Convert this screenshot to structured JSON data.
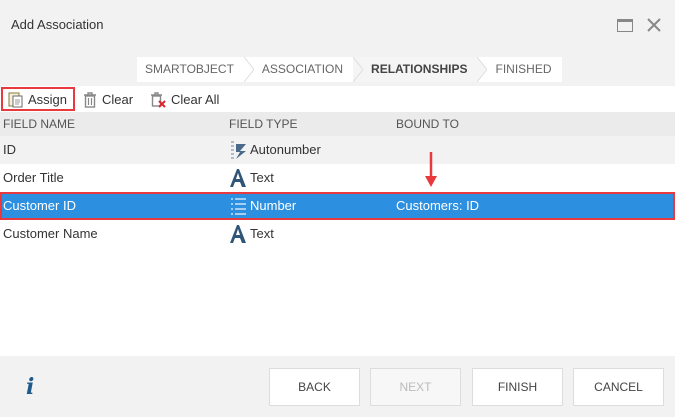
{
  "dialog": {
    "title": "Add Association"
  },
  "steps": [
    {
      "label": "SMARTOBJECT",
      "active": false
    },
    {
      "label": "ASSOCIATION",
      "active": false
    },
    {
      "label": "RELATIONSHIPS",
      "active": true
    },
    {
      "label": "FINISHED",
      "active": false
    }
  ],
  "toolbar": {
    "assign_label": "Assign",
    "clear_label": "Clear",
    "clear_all_label": "Clear All"
  },
  "grid": {
    "headers": {
      "field_name": "FIELD NAME",
      "field_type": "FIELD TYPE",
      "bound_to": "BOUND TO"
    },
    "rows": [
      {
        "field_name": "ID",
        "field_type": "Autonumber",
        "type_icon": "autonumber-icon",
        "bound_to": ""
      },
      {
        "field_name": "Order Title",
        "field_type": "Text",
        "type_icon": "text-type-icon",
        "bound_to": ""
      },
      {
        "field_name": "Customer ID",
        "field_type": "Number",
        "type_icon": "number-icon",
        "bound_to": "Customers: ID"
      },
      {
        "field_name": "Customer Name",
        "field_type": "Text",
        "type_icon": "text-type-icon",
        "bound_to": ""
      }
    ]
  },
  "footer": {
    "back_label": "BACK",
    "next_label": "NEXT",
    "finish_label": "FINISH",
    "cancel_label": "CANCEL"
  },
  "colors": {
    "selection": "#2d8fe0",
    "highlight": "#e8393f",
    "accent": "#1e5a8a"
  }
}
